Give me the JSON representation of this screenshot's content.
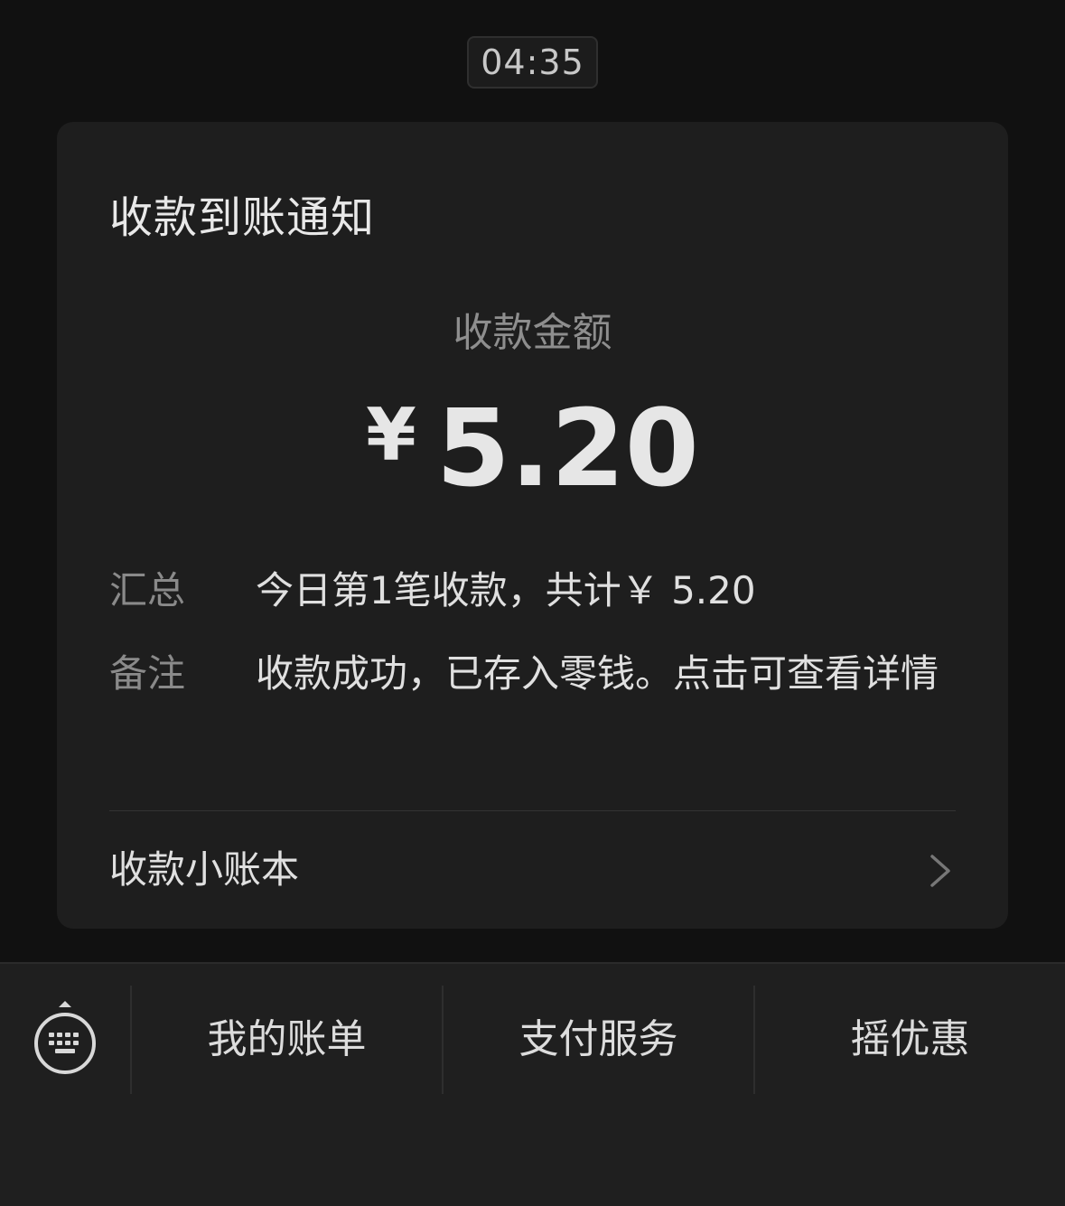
{
  "timestamp": "04:35",
  "card": {
    "title": "收款到账通知",
    "amount_label": "收款金额",
    "currency_symbol": "¥",
    "amount_value": "5.20",
    "summary_key": "汇总",
    "summary_value": "今日第1笔收款，共计￥ 5.20",
    "note_key": "备注",
    "note_value": "收款成功，已存入零钱。点击可查看详情",
    "ledger_link_label": "收款小账本"
  },
  "bottom_menu": {
    "keyboard_icon": "keyboard-icon",
    "items": [
      {
        "label": "我的账单"
      },
      {
        "label": "支付服务"
      },
      {
        "label": "摇优惠"
      }
    ]
  },
  "colors": {
    "background": "#111111",
    "card": "#1e1e1e",
    "bottom_bar": "#1f1f1f",
    "text_primary": "#e0e0e0",
    "text_secondary": "#8a8a8a"
  }
}
